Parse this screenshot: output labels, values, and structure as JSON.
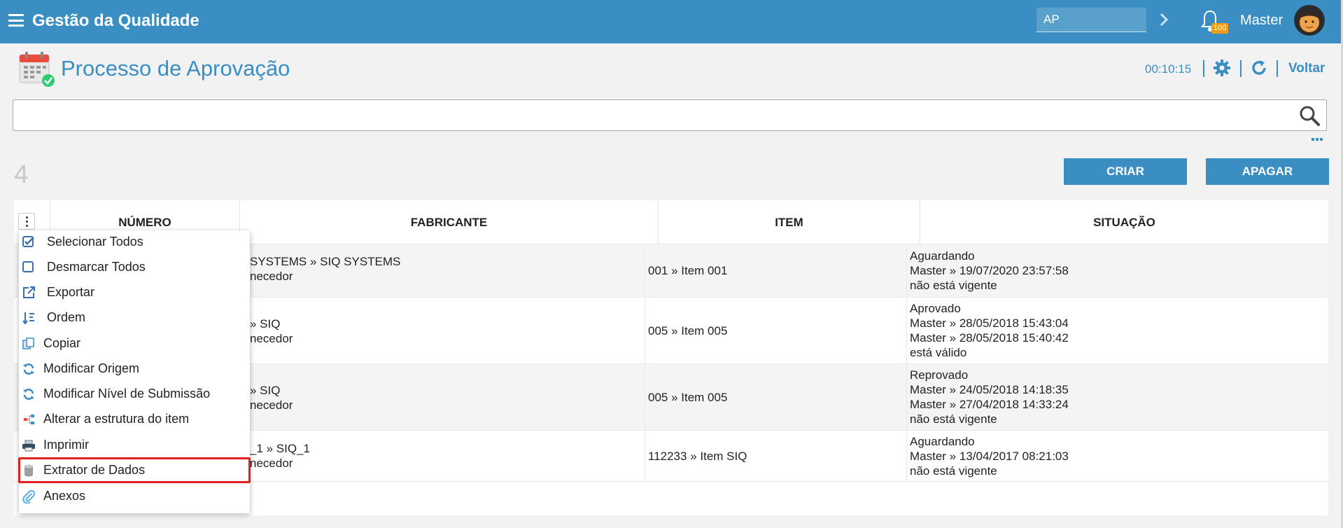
{
  "app": {
    "title": "Gestão da Qualidade"
  },
  "topbar": {
    "ap_value": "AP",
    "notifications_count": "100",
    "user_name": "Master"
  },
  "page": {
    "title": "Processo de Aprovação",
    "timer": "00:10:15",
    "back_label": "Voltar"
  },
  "search": {
    "value": "",
    "placeholder": ""
  },
  "list": {
    "count": "4",
    "create_label": "CRIAR",
    "delete_label": "APAGAR"
  },
  "table": {
    "columns": [
      "NÚMERO",
      "FABRICANTE",
      "ITEM",
      "SITUAÇÃO"
    ],
    "rows": [
      {
        "fabricante_1": "SYSTEMS » SIQ SYSTEMS",
        "fabricante_2": "necedor",
        "item": "001 » Item 001",
        "situacao": [
          "Aguardando",
          "Master » 19/07/2020 23:57:58",
          "não está vigente"
        ]
      },
      {
        "fabricante_1": "» SIQ",
        "fabricante_2": "necedor",
        "item": "005 » Item 005",
        "situacao": [
          "Aprovado",
          "Master » 28/05/2018 15:43:04",
          "Master » 28/05/2018 15:40:42",
          "está válido"
        ]
      },
      {
        "fabricante_1": "» SIQ",
        "fabricante_2": "necedor",
        "item": "005 » Item 005",
        "situacao": [
          "Reprovado",
          "Master » 24/05/2018 14:18:35",
          "Master » 27/04/2018 14:33:24",
          "não está vigente"
        ]
      },
      {
        "fabricante_1": "_1 » SIQ_1",
        "fabricante_2": "necedor",
        "item": "112233 » Item SIQ",
        "situacao": [
          "Aguardando",
          "Master » 13/04/2017 08:21:03",
          "não está vigente"
        ]
      }
    ]
  },
  "menu": {
    "items": [
      {
        "label": "Selecionar Todos",
        "icon": "checkbox-checked-icon"
      },
      {
        "label": "Desmarcar Todos",
        "icon": "checkbox-empty-icon"
      },
      {
        "label": "Exportar",
        "icon": "export-icon"
      },
      {
        "label": "Ordem",
        "icon": "sort-icon"
      },
      {
        "label": "Copiar",
        "icon": "copy-icon"
      },
      {
        "label": "Modificar Origem",
        "icon": "sync-icon"
      },
      {
        "label": "Modificar Nível de Submissão",
        "icon": "sync-icon"
      },
      {
        "label": "Alterar a estrutura do item",
        "icon": "structure-icon"
      },
      {
        "label": "Imprimir",
        "icon": "printer-icon"
      },
      {
        "label": "Extrator de Dados",
        "icon": "database-icon"
      },
      {
        "label": "Anexos",
        "icon": "paperclip-icon"
      }
    ],
    "highlighted": "Extrator de Dados"
  },
  "colors": {
    "primary": "#3b8ec2",
    "badge": "#f39c12",
    "highlight": "#e02020"
  }
}
